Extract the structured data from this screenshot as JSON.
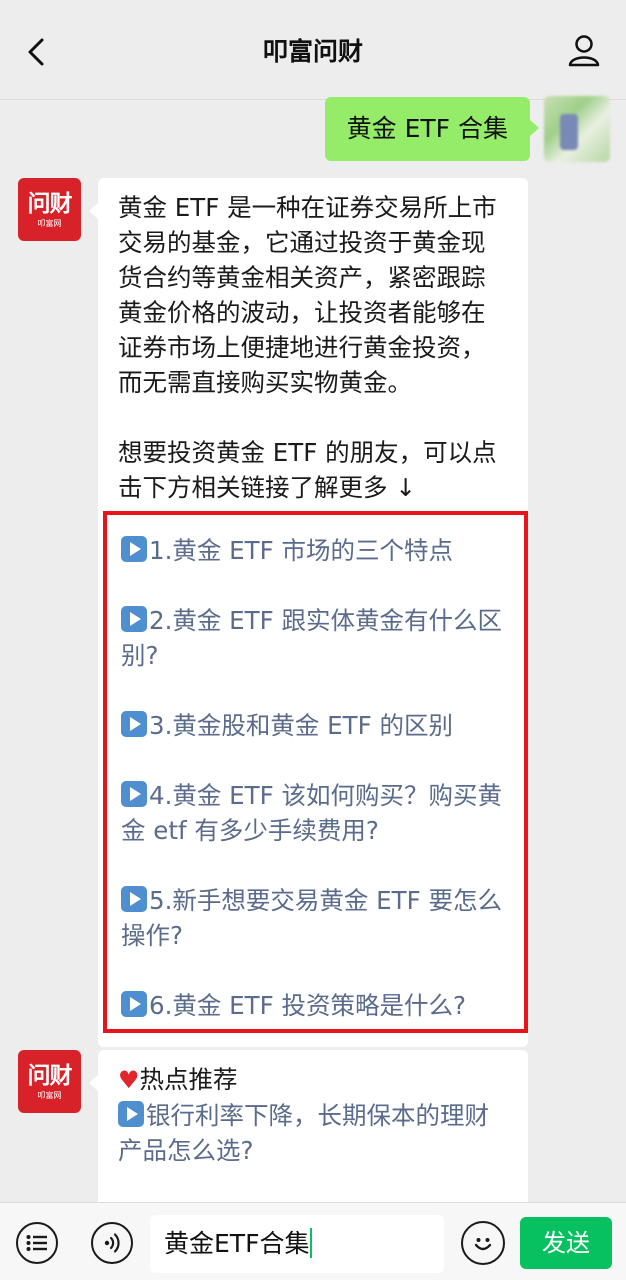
{
  "header": {
    "title": "叩富问财",
    "back_icon": "chevron-left-icon",
    "profile_icon": "person-icon"
  },
  "messages": {
    "outgoing": {
      "text": "黄金 ETF 合集"
    },
    "bot_logo": {
      "main": "问财",
      "sub": "叩富网"
    },
    "reply": {
      "paragraph1": "黄金 ETF 是一种在证券交易所上市交易的基金，它通过投资于黄金现货合约等黄金相关资产，紧密跟踪黄金价格的波动，让投资者能够在证券市场上便捷地进行黄金投资，而无需直接购买实物黄金。",
      "paragraph2": "想要投资黄金 ETF 的朋友，可以点击下方相关链接了解更多 ↓",
      "links": [
        "1.黄金 ETF 市场的三个特点",
        "2.黄金 ETF 跟实体黄金有什么区别?",
        "3.黄金股和黄金 ETF 的区别",
        "4.黄金 ETF 该如何购买？购买黄金 etf 有多少手续费用?",
        "5.新手想要交易黄金 ETF 要怎么操作?",
        "6.黄金 ETF 投资策略是什么?"
      ]
    },
    "hot": {
      "title": "热点推荐",
      "item": "银行利率下降，长期保本的理财产品怎么选?"
    }
  },
  "bottom_bar": {
    "input_value": "黄金ETF合集",
    "send_label": "发送"
  },
  "colors": {
    "background": "#ededed",
    "outgoing_bubble": "#95ec69",
    "link_text": "#5b6b8c",
    "highlight_border": "#e8141c",
    "send_button": "#07c160",
    "logo_red": "#d7222a"
  }
}
